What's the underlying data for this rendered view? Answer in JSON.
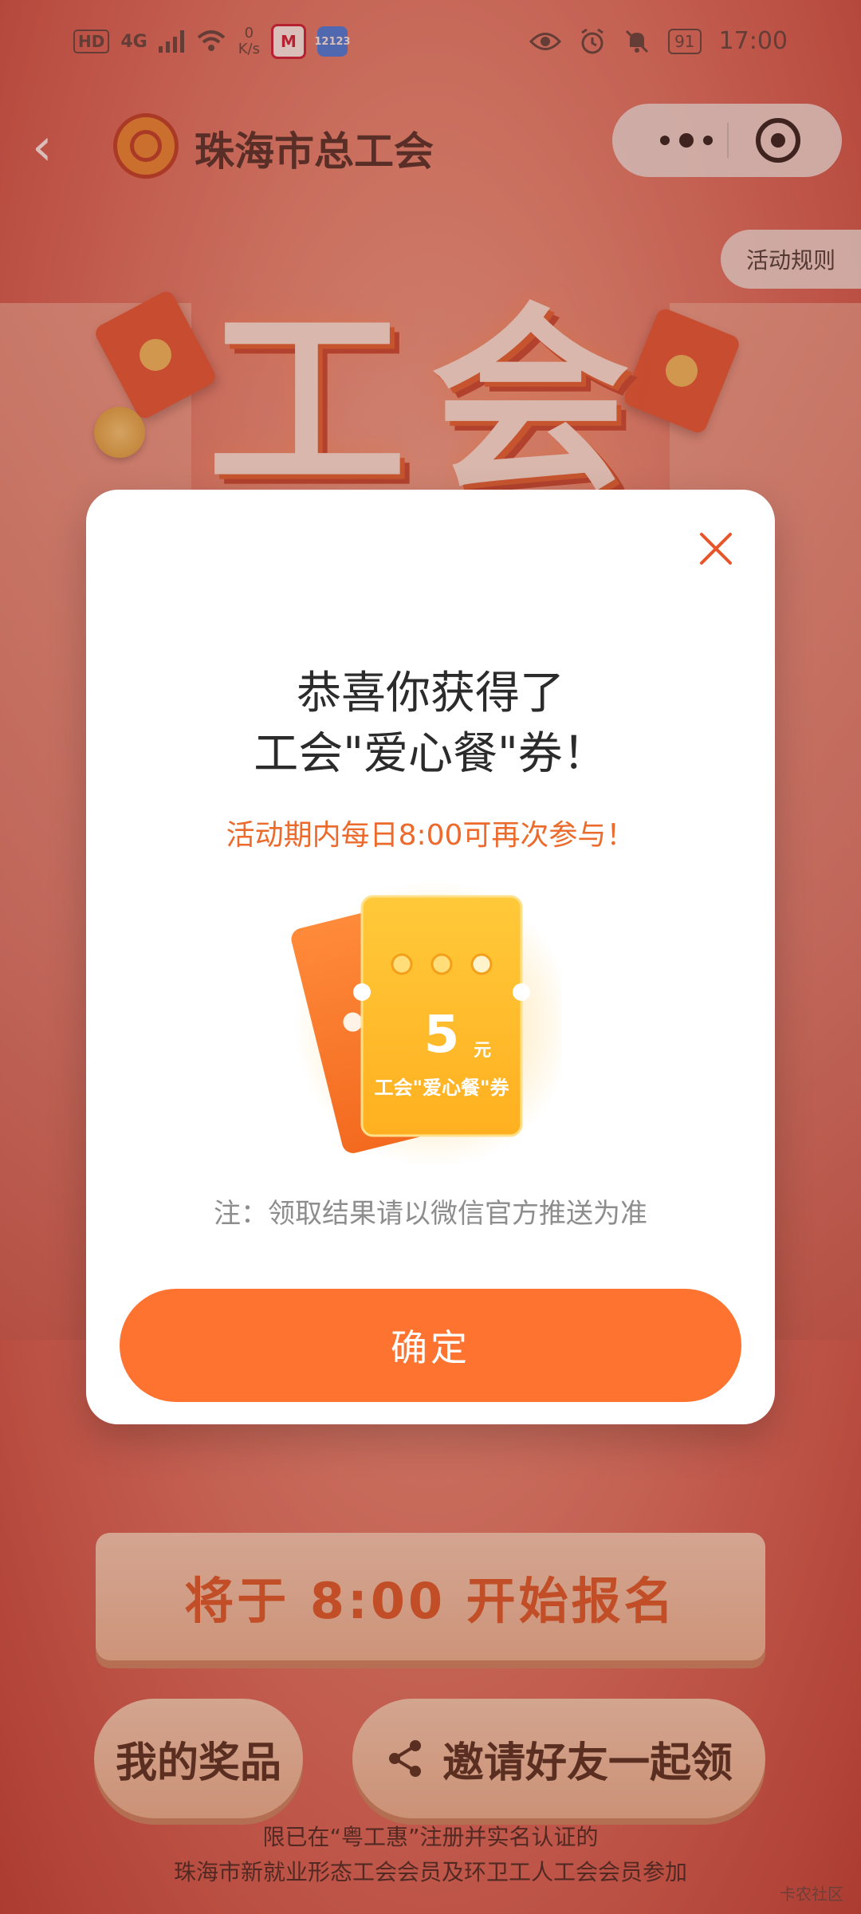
{
  "status_bar": {
    "hd": "HD",
    "signal": "4G",
    "net_speed_value": "0",
    "net_speed_unit": "K/s",
    "app1_label": "M",
    "app2_label": "12123",
    "battery": "91",
    "time": "17:00"
  },
  "nav": {
    "back_icon": "‹",
    "org_name": "珠海市总工会"
  },
  "rules_tab": "活动规则",
  "hero_title": "工会",
  "modal": {
    "title_line1": "恭喜你获得了",
    "title_line2": "工会\"爱心餐\"券！",
    "subtitle": "活动期内每日8:00可再次参与！",
    "coupon_amount": "5",
    "coupon_unit": "元",
    "coupon_name": "工会\"爱心餐\"券",
    "note": "注：领取结果请以微信官方推送为准",
    "confirm_label": "确定"
  },
  "signup_banner": "将于 8:00 开始报名",
  "buttons": {
    "my_prizes": "我的奖品",
    "invite": "邀请好友一起领"
  },
  "footer": {
    "line1": "限已在“粤工惠”注册并实名认证的",
    "line2": "珠海市新就业形态工会会员及环卫工人工会会员参加"
  },
  "watermark": "卡农社区",
  "colors": {
    "accent": "#ff7330",
    "subtitle": "#ec6a2c",
    "background": "#c9483f"
  }
}
